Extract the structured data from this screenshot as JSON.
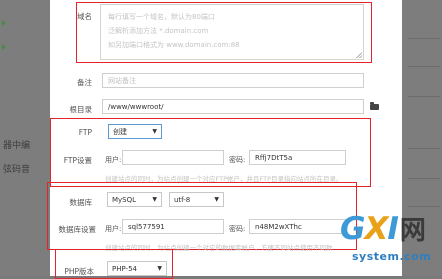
{
  "background": {
    "left_fragments": [
      "器中编",
      "弦码音"
    ]
  },
  "form": {
    "domain": {
      "label": "域名",
      "placeholder_lines": [
        "每行填写一个域名，默认为80端口",
        "泛解析添加方法 *.domain.com",
        "如另加端口格式为 www.domain.com:88"
      ]
    },
    "remark": {
      "label": "备注",
      "placeholder": "网站备注"
    },
    "root": {
      "label": "根目录",
      "value": "/www/wwwroot/",
      "icon": "folder-icon"
    },
    "ftp": {
      "label": "FTP",
      "select_value": "创建",
      "settings_label": "FTP设置",
      "user_label": "用户:",
      "user_value": "",
      "password_label": "密码:",
      "password_value": "Rffj7DtT5a",
      "hint": "创建站点的同时，为站点创建一个对应FTP帐户，并且FTP目录指向站点所在目录。"
    },
    "database": {
      "label": "数据库",
      "type_value": "MySQL",
      "charset_value": "utf-8",
      "settings_label": "数据库设置",
      "user_label": "用户:",
      "user_value": "sql577591",
      "password_label": "密码:",
      "password_value": "n48M2wXThc",
      "hint": "创建站点的同时，为站点创建一个对应的数据库帐户，方便不同站点使用不同数"
    },
    "php": {
      "label": "PHP版本",
      "value": "PHP-54"
    }
  },
  "watermark": {
    "logo_g": "G",
    "logo_x": "X",
    "logo_i": "I",
    "logo_cn": "网",
    "url": "system.com"
  },
  "colors": {
    "highlight": "#e2252b",
    "overlay": "#7a7a7a"
  }
}
